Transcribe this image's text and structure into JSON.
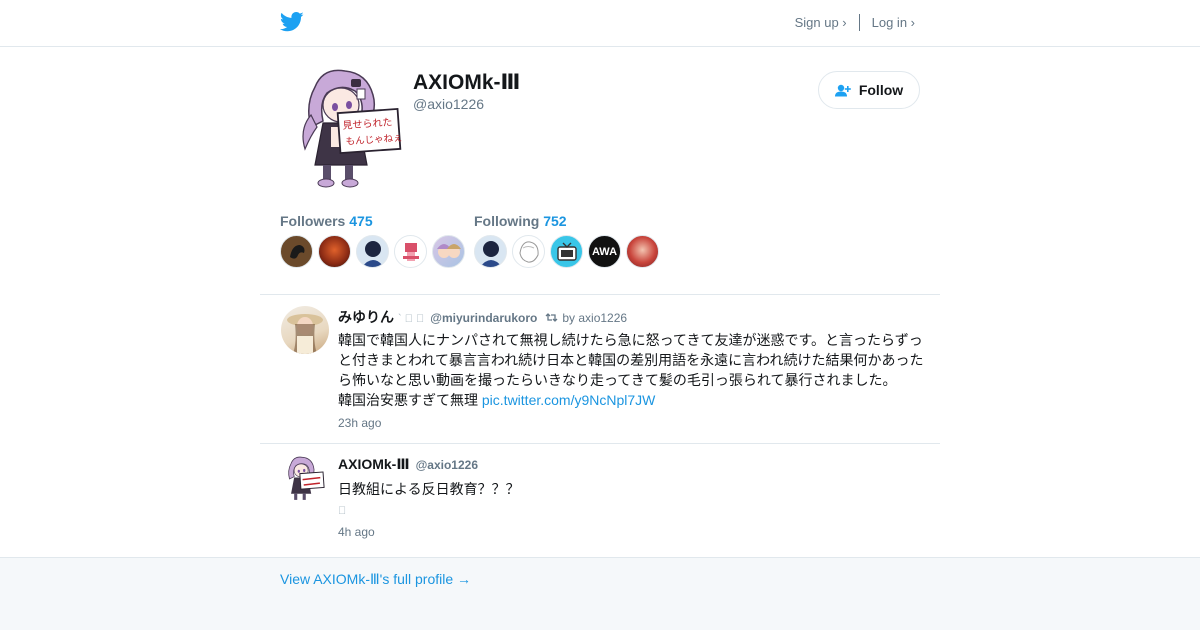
{
  "header": {
    "logo_icon": "twitter-bird-icon",
    "brand_color": "#1da1f2",
    "signup_label": "Sign up ›",
    "login_label": "Log in ›"
  },
  "profile": {
    "name": "AXIOMk-Ⅲ",
    "handle": "@axio1226",
    "follow_label": "Follow",
    "avatar_sign_line1": "見せられた",
    "avatar_sign_line2": "もんじゃねぇ"
  },
  "stats": {
    "followers_label": "Followers",
    "followers_count": "475",
    "following_label": "Following",
    "following_count": "752",
    "following_badge_text": "AWA"
  },
  "tweets": [
    {
      "author_name": "みゆりん",
      "author_glyphs": "` 󾠶 󾠶",
      "author_handle": "@miyurindarukoro",
      "retweet_label": "by axio1226",
      "text": "韓国で韓国人にナンパされて無視し続けたら急に怒ってきて友達が迷惑です。と言ったらずっと付きまとわれて暴言言われ続け日本と韓国の差別用語を永遠に言われ続けた結果何かあったら怖いなと思い動画を撮ったらいきなり走ってきて髪の毛引っ張られて暴行されました。",
      "text_line2": "韓国治安悪すぎて無理 ",
      "link": "pic.twitter.com/y9NcNpl7JW",
      "time": "23h ago"
    },
    {
      "author_name": "AXIOMk-Ⅲ",
      "author_handle": "@axio1226",
      "text": "日教組による反日教育？？？",
      "emoji_placeholder": "󾠶",
      "time": "4h ago"
    }
  ],
  "footer": {
    "full_profile_link": "View AXIOMk-Ⅲ's full profile →"
  }
}
